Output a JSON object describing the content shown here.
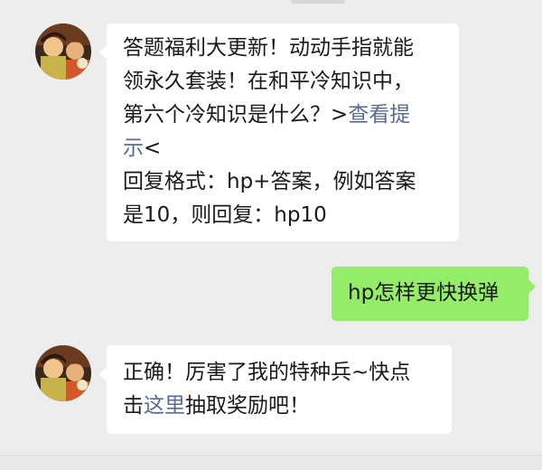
{
  "chat": {
    "messages": [
      {
        "sender": "official-account",
        "direction": "incoming",
        "lines": [
          {
            "text": "答题福利大更新！动动手指就能"
          },
          {
            "text": "领永久套装！在和平冷知识中，"
          },
          {
            "text": "第六个冷知识是什么？>",
            "link": "查看提"
          },
          {
            "link": "示",
            "after": "<"
          },
          {
            "text": "回复格式：hp+答案，例如答案"
          },
          {
            "text": "是10，则回复：hp10"
          }
        ]
      },
      {
        "sender": "me",
        "direction": "outgoing",
        "text": "hp怎样更快换弹"
      },
      {
        "sender": "official-account",
        "direction": "incoming",
        "lines": [
          {
            "text": "正确！厉害了我的特种兵~快点"
          },
          {
            "text": "击",
            "link": "这里",
            "after": "抽取奖励吧！"
          }
        ]
      }
    ]
  },
  "colors": {
    "background": "#ededed",
    "incoming_bubble": "#ffffff",
    "outgoing_bubble": "#95ec69",
    "link": "#576b95"
  },
  "icons": {
    "avatar": "game-character-avatar"
  }
}
